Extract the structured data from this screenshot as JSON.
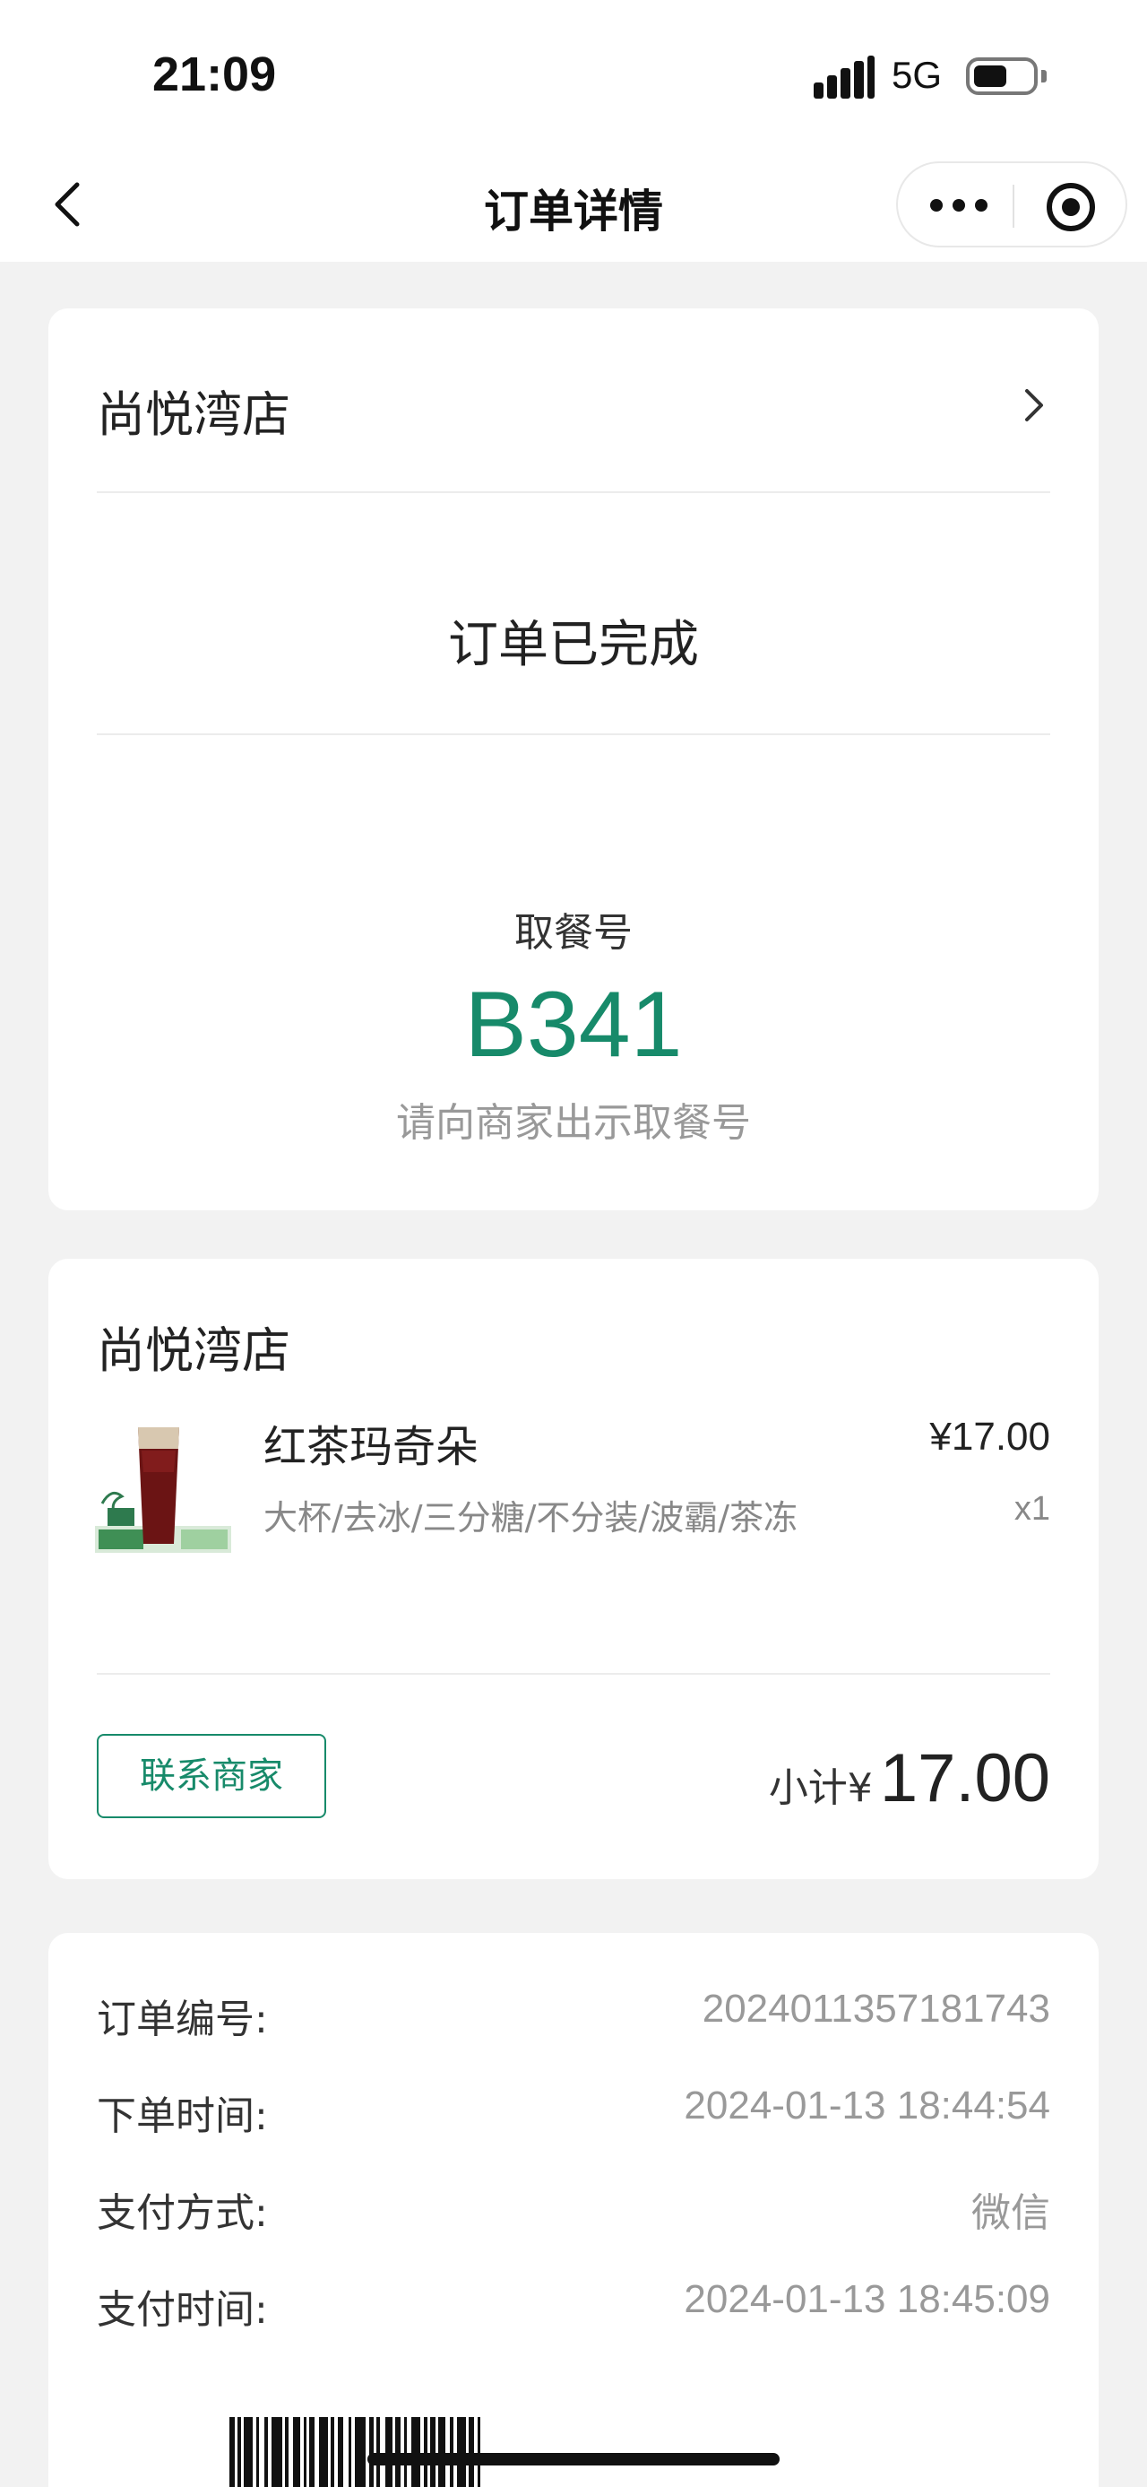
{
  "status_bar": {
    "time": "21:09",
    "network": "5G"
  },
  "nav": {
    "title": "订单详情"
  },
  "order": {
    "store_name": "尚悦湾店",
    "status": "订单已完成",
    "pickup": {
      "label": "取餐号",
      "number": "B341",
      "hint": "请向商家出示取餐号"
    }
  },
  "items_card": {
    "store_name": "尚悦湾店",
    "items": [
      {
        "name": "红茶玛奇朵",
        "price": "¥17.00",
        "spec": "大杯/去冰/三分糖/不分装/波霸/茶冻",
        "qty": "x1"
      }
    ],
    "contact_label": "联系商家",
    "subtotal_label": "小计¥",
    "subtotal_value": "17.00"
  },
  "info": [
    {
      "key": "订单编号:",
      "value": "2024011357181743"
    },
    {
      "key": "下单时间:",
      "value": "2024-01-13 18:44:54"
    },
    {
      "key": "支付方式:",
      "value": "微信"
    },
    {
      "key": "支付时间:",
      "value": "2024-01-13 18:45:09"
    }
  ],
  "colors": {
    "accent": "#178a6a",
    "background": "#f2f2f2",
    "card": "#ffffff",
    "muted": "#999999"
  },
  "icons": [
    "back-icon",
    "more-icon",
    "target-icon",
    "chevron-right-icon",
    "signal-icon",
    "battery-icon"
  ]
}
